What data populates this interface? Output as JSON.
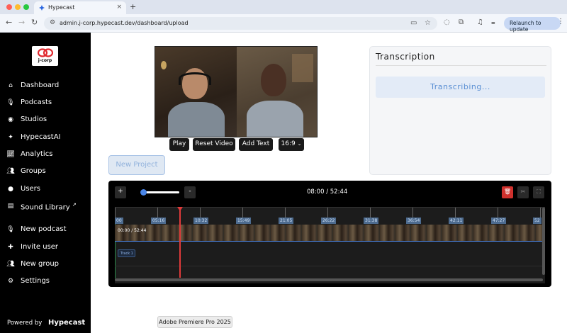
{
  "browser": {
    "tab_title": "Hypecast",
    "tab_close": "×",
    "new_tab": "+",
    "url": "admin.j-corp.hypecast.dev/dashboard/upload",
    "relaunch_label": "Relaunch to update",
    "accent_color": "#c8d8f4"
  },
  "sidebar": {
    "brand": "j-corp",
    "items": [
      {
        "label": "Dashboard",
        "icon": "home-icon"
      },
      {
        "label": "Podcasts",
        "icon": "microphone-icon"
      },
      {
        "label": "Studios",
        "icon": "record-icon"
      },
      {
        "label": "HypecastAI",
        "icon": "sparkle-icon"
      },
      {
        "label": "Analytics",
        "icon": "chart-icon"
      },
      {
        "label": "Groups",
        "icon": "group-icon"
      },
      {
        "label": "Users",
        "icon": "user-icon"
      },
      {
        "label": "Sound Library",
        "icon": "music-library-icon",
        "external": true
      }
    ],
    "actions": [
      {
        "label": "New podcast",
        "icon": "add-microphone-icon"
      },
      {
        "label": "Invite user",
        "icon": "add-user-icon"
      },
      {
        "label": "New group",
        "icon": "add-group-icon"
      },
      {
        "label": "Settings",
        "icon": "gear-icon"
      }
    ],
    "powered_by": "Powered by",
    "powered_brand": "Hypecast"
  },
  "player": {
    "buttons": [
      "Play",
      "Reset Video",
      "Add Text"
    ],
    "aspect_ratio": "16:9",
    "new_project": "New Project"
  },
  "transcription": {
    "title": "Transcription",
    "status": "Transcribing..."
  },
  "editor": {
    "zoom_in": "+",
    "zoom_out": "-",
    "timecode": "08:00 / 52:44",
    "thumb_timecode": "00:00 / 52:44",
    "track_label": "Track 1",
    "ruler_labels": [
      "00",
      "05:16",
      "10:32",
      "15:49",
      "21:05",
      "26:22",
      "31:38",
      "36:54",
      "42:11",
      "47:27",
      "52"
    ],
    "delete_color": "#d0312d"
  },
  "dock": {
    "tooltip": "Adobe Premiere Pro 2025"
  }
}
